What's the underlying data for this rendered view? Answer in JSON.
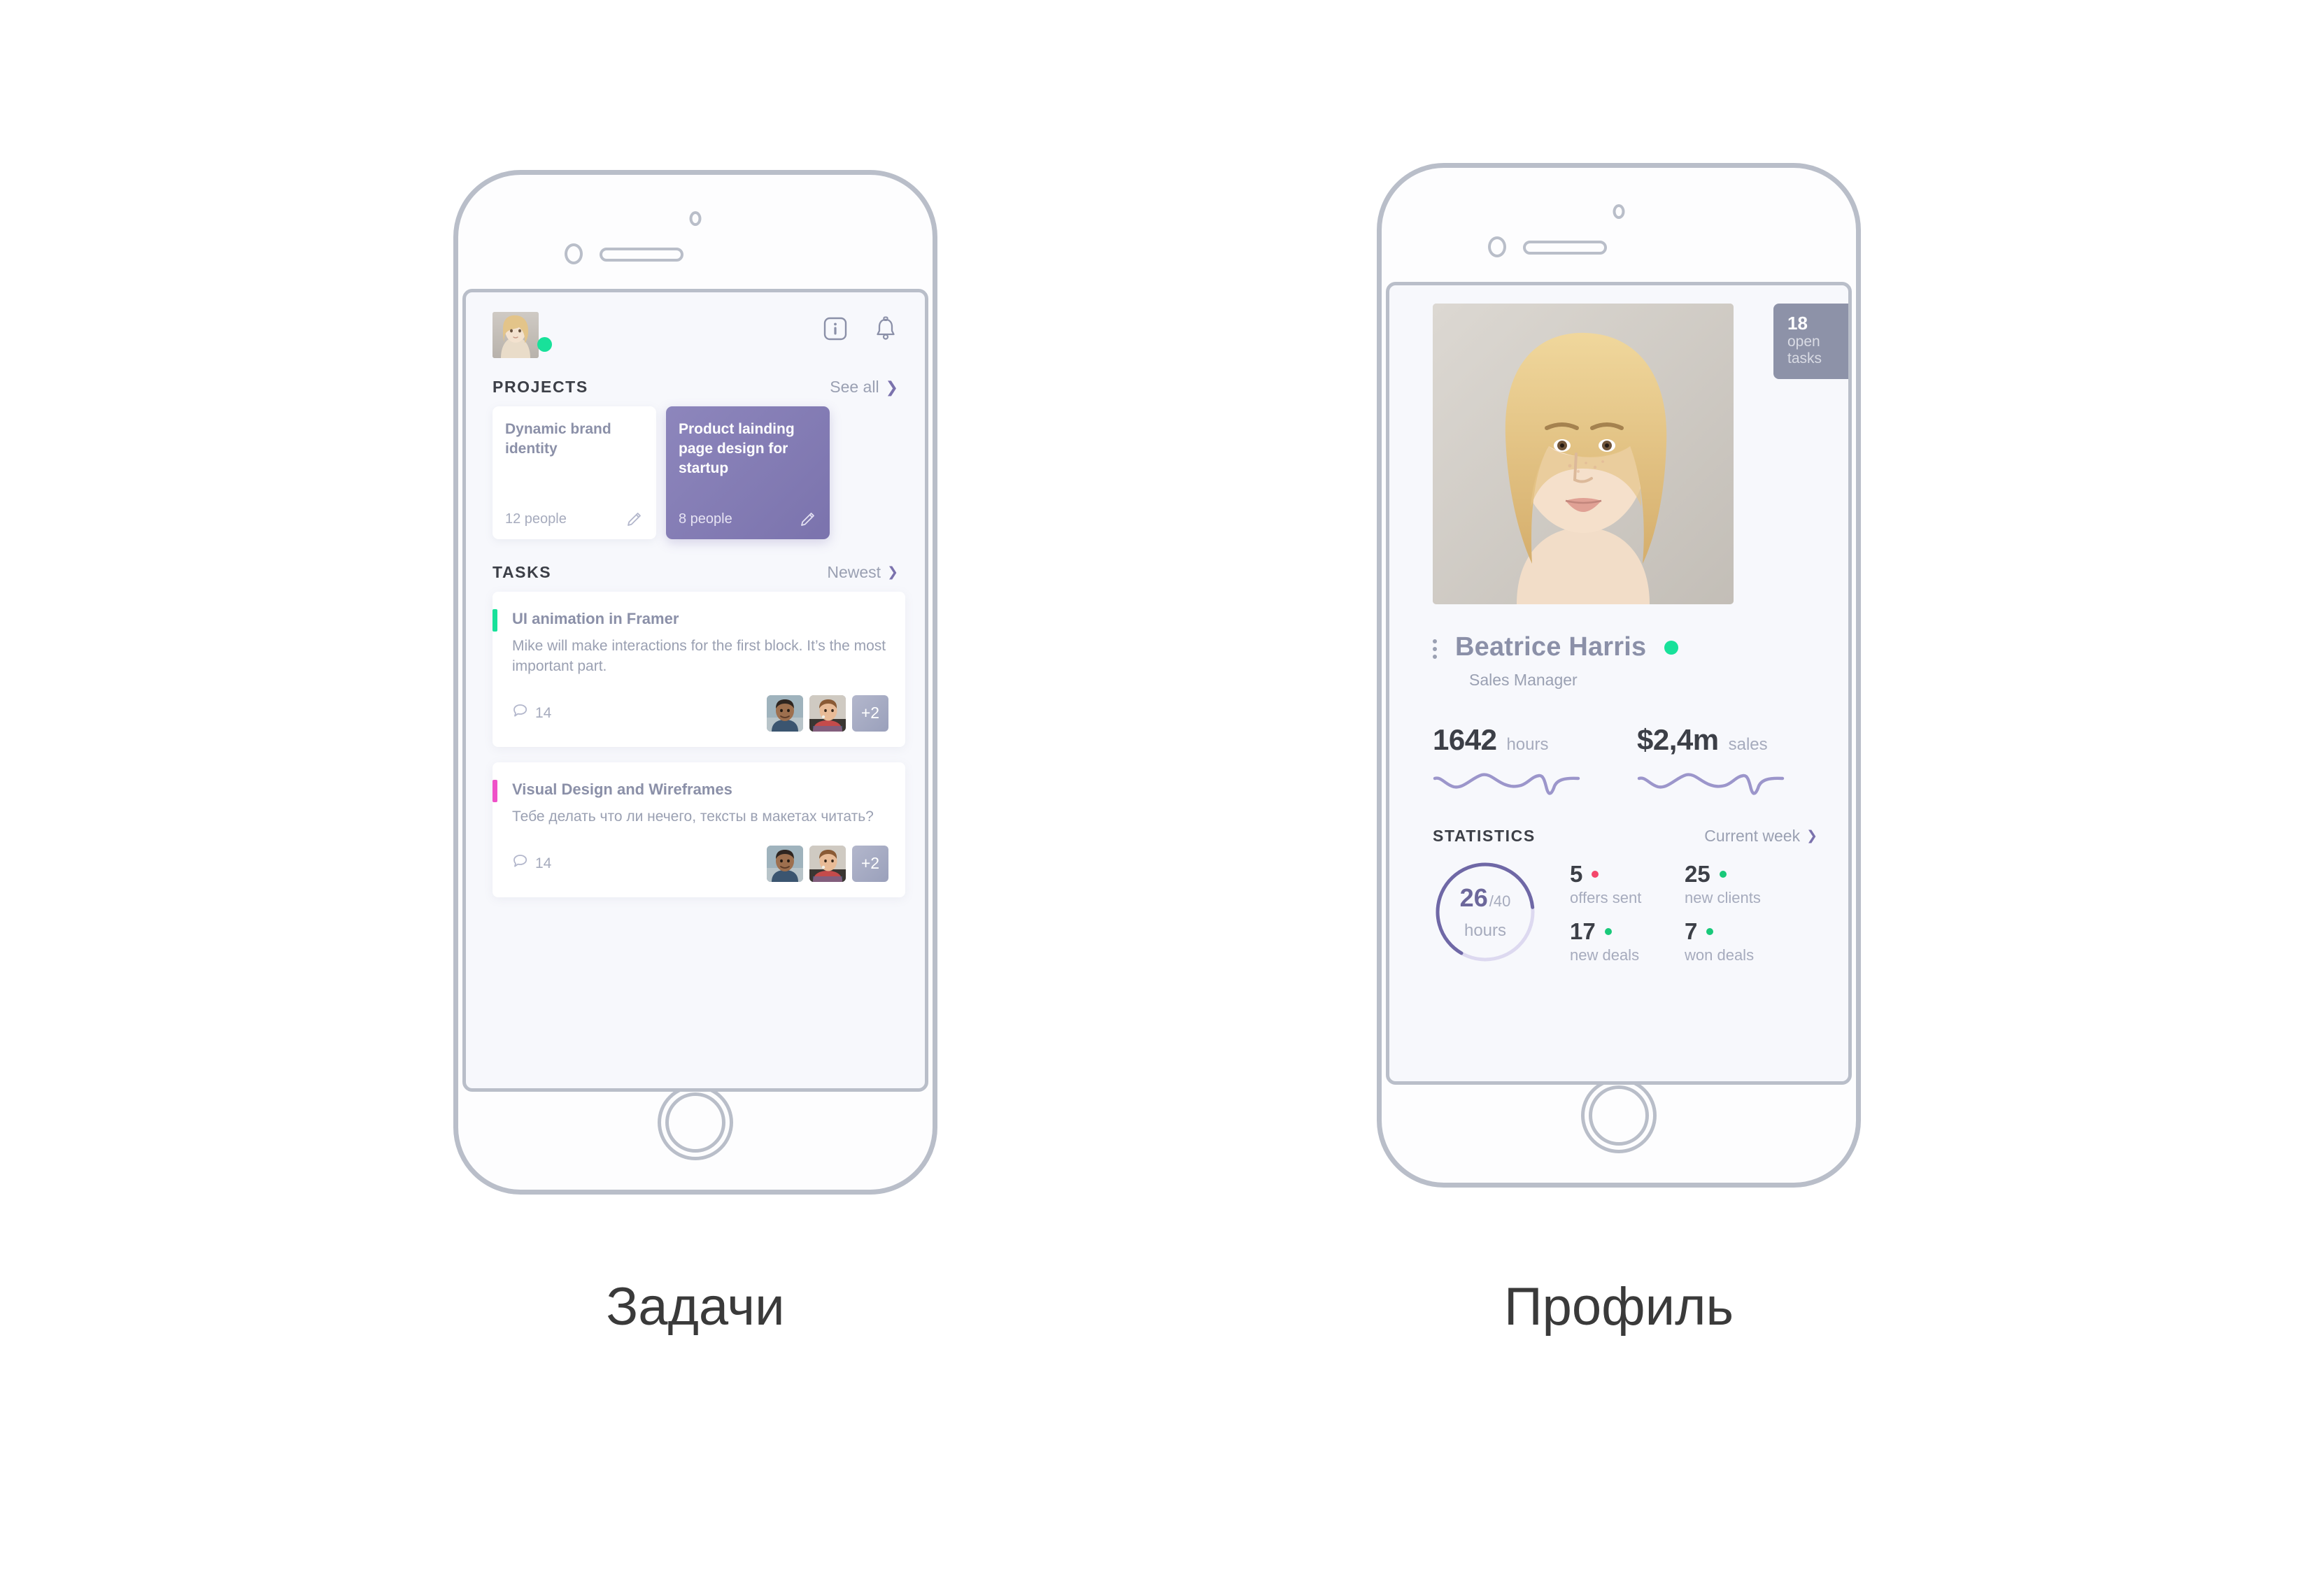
{
  "captions": {
    "left": "Задачи",
    "right": "Профиль"
  },
  "colors": {
    "accent_purple": "#7b73ad",
    "accent_purple_light": "#8d86bc",
    "online_green": "#18e19a",
    "badge_gray": "#8d92a8",
    "text_muted": "#9aa0b2",
    "text_dark": "#3c3f47",
    "task_bar_green": "#18e19a",
    "task_bar_pink": "#ef51c8",
    "metric_red": "#f4476b",
    "metric_green": "#19c97a",
    "frame_gray": "#b9bec9",
    "screen_bg": "#f7f8fc"
  },
  "tasks_screen": {
    "header": {
      "avatar_name": "user-avatar",
      "status": "online",
      "info_icon": "info-icon",
      "bell_icon": "bell-icon"
    },
    "projects": {
      "title": "PROJECTS",
      "see_all": "See all",
      "chevron": "chevron-right-icon",
      "cards": [
        {
          "title": "Dynamic brand identity",
          "people": "12 people",
          "edit_icon": "pencil-icon",
          "accent": false
        },
        {
          "title": "Product lainding page design for startup",
          "people": "8 people",
          "edit_icon": "pencil-icon",
          "accent": true
        }
      ]
    },
    "tasks": {
      "title": "TASKS",
      "sort_label": "Newest",
      "sort_chevron": "chevron-down-icon",
      "items": [
        {
          "bar_color": "#18e19a",
          "title": "UI animation in Framer",
          "description": "Mike will make interactions for the first block. It’s the most important part.",
          "comments": "14",
          "comment_icon": "comment-icon",
          "extra_people": "+2"
        },
        {
          "bar_color": "#ef51c8",
          "title": "Visual Design and Wireframes",
          "description": "Тебе делать что ли нечего, тексты в макетах читать?",
          "comments": "14",
          "comment_icon": "comment-icon",
          "extra_people": "+2"
        }
      ]
    }
  },
  "profile_screen": {
    "hero_photo": "profile-photo",
    "open_tasks": {
      "count": "18",
      "label_line1": "open",
      "label_line2": "tasks"
    },
    "kebab_icon": "kebab-menu-icon",
    "name": "Beatrice Harris",
    "status": "online",
    "role": "Sales Manager",
    "kpis": [
      {
        "value": "1642",
        "unit": "hours",
        "spark": "sparkline-hours"
      },
      {
        "value": "$2,4m",
        "unit": "sales",
        "spark": "sparkline-sales"
      }
    ],
    "statistics": {
      "title": "STATISTICS",
      "period": "Current week",
      "period_chevron": "chevron-down-icon",
      "donut": {
        "value": "26",
        "denominator": "/40",
        "sub": "hours"
      },
      "metrics": [
        {
          "number": "5",
          "label": "offers sent",
          "dot": "#f4476b"
        },
        {
          "number": "25",
          "label": "new clients",
          "dot": "#19c97a"
        },
        {
          "number": "17",
          "label": "new deals",
          "dot": "#19c97a"
        },
        {
          "number": "7",
          "label": "won deals",
          "dot": "#19c97a"
        }
      ]
    }
  },
  "chart_data": [
    {
      "type": "line",
      "title": "hours sparkline",
      "x": [
        0,
        1,
        2,
        3,
        4,
        5,
        6,
        7,
        8,
        9,
        10,
        11
      ],
      "values": [
        0.55,
        0.3,
        0.22,
        0.35,
        0.62,
        0.66,
        0.5,
        0.38,
        0.45,
        0.6,
        0.95,
        0.15
      ],
      "ylim": [
        0,
        1
      ],
      "grid": false,
      "legend": "none"
    },
    {
      "type": "line",
      "title": "sales sparkline",
      "x": [
        0,
        1,
        2,
        3,
        4,
        5,
        6,
        7,
        8,
        9,
        10,
        11
      ],
      "values": [
        0.55,
        0.3,
        0.22,
        0.35,
        0.62,
        0.66,
        0.5,
        0.38,
        0.45,
        0.6,
        0.95,
        0.15
      ],
      "ylim": [
        0,
        1
      ],
      "grid": false,
      "legend": "none"
    },
    {
      "type": "pie",
      "title": "26/40 hours",
      "categories": [
        "completed hours",
        "remaining hours"
      ],
      "values": [
        26,
        14
      ],
      "ylabel": "hours",
      "legend": "none"
    }
  ]
}
